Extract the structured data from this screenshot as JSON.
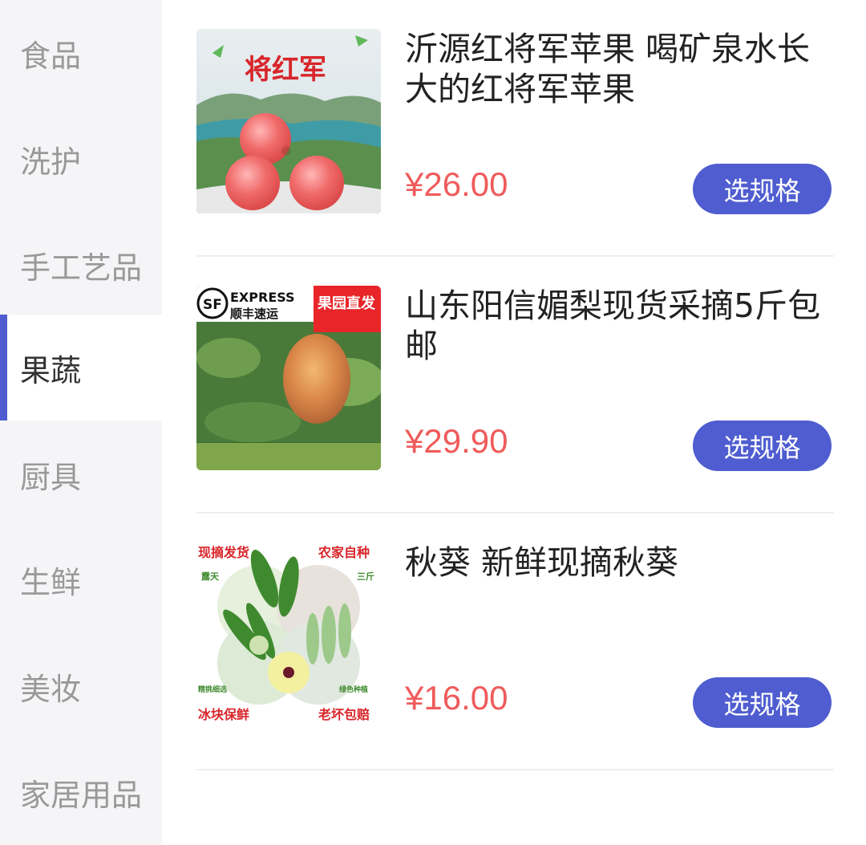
{
  "sidebar": {
    "items": [
      {
        "label": "食品",
        "active": false
      },
      {
        "label": "洗护",
        "active": false
      },
      {
        "label": "手工艺品",
        "active": false
      },
      {
        "label": "果蔬",
        "active": true
      },
      {
        "label": "厨具",
        "active": false
      },
      {
        "label": "生鲜",
        "active": false
      },
      {
        "label": "美妆",
        "active": false
      },
      {
        "label": "家居用品",
        "active": false
      }
    ]
  },
  "products": [
    {
      "title": "沂源红将军苹果 喝矿泉水长大的红将军苹果",
      "price": "¥26.00",
      "button": "选规格",
      "image_text": {
        "big": "将红军"
      }
    },
    {
      "title": "山东阳信媚梨现货采摘5斤包邮",
      "price": "¥29.90",
      "button": "选规格",
      "image_text": {
        "brand": "EXPRESS",
        "sub": "顺丰速运",
        "badge": "果园直发",
        "logo": "SF"
      }
    },
    {
      "title": "秋葵 新鲜现摘秋葵",
      "price": "¥16.00",
      "button": "选规格",
      "image_text": {
        "tl": "现摘发货",
        "tr": "农家自种",
        "ml": "露天",
        "mr": "三斤",
        "bl_small": "精挑细选",
        "br_small": "绿色种植",
        "bl": "冰块保鲜",
        "br": "老坏包赔"
      }
    }
  ],
  "colors": {
    "accent": "#4f5dd0",
    "price": "#ef5b5b",
    "sidebar_bg": "#f5f5f7"
  }
}
